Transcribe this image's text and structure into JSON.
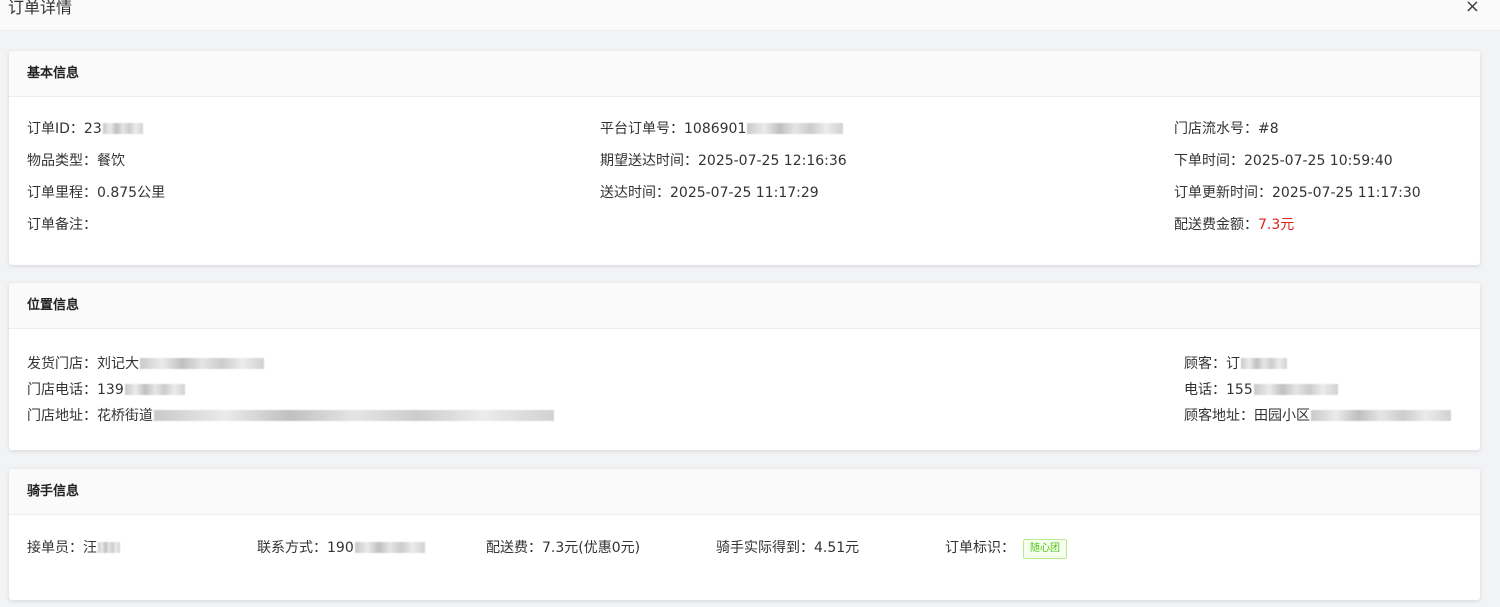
{
  "header": {
    "title": "订单详情",
    "close_symbol": "×"
  },
  "basic": {
    "title": "基本信息",
    "order_id": {
      "label": "订单ID：",
      "value": "23"
    },
    "platform_order_no": {
      "label": "平台订单号：",
      "value": "1086901"
    },
    "store_serial": {
      "label": "门店流水号：",
      "value": "#8"
    },
    "item_type": {
      "label": "物品类型：",
      "value": "餐饮"
    },
    "expected_delivery": {
      "label": "期望送达时间：",
      "value": "2025-07-25 12:16:36"
    },
    "order_time": {
      "label": "下单时间：",
      "value": "2025-07-25 10:59:40"
    },
    "distance": {
      "label": "订单里程：",
      "value": "0.875公里"
    },
    "delivered_time": {
      "label": "送达时间：",
      "value": "2025-07-25 11:17:29"
    },
    "update_time": {
      "label": "订单更新时间：",
      "value": "2025-07-25 11:17:30"
    },
    "remark": {
      "label": "订单备注：",
      "value": ""
    },
    "delivery_fee": {
      "label": "配送费金额：",
      "value": "7.3元"
    }
  },
  "location": {
    "title": "位置信息",
    "store": {
      "label": "发货门店：",
      "value": "刘记大"
    },
    "store_phone": {
      "label": "门店电话：",
      "value": "139"
    },
    "store_address": {
      "label": "门店地址：",
      "value": "花桥街道"
    },
    "customer": {
      "label": "顾客：",
      "value": "订"
    },
    "customer_phone": {
      "label": "电话：",
      "value": "155"
    },
    "customer_address": {
      "label": "顾客地址：",
      "value": "田园小区"
    }
  },
  "rider": {
    "title": "骑手信息",
    "receiver": {
      "label": "接单员：",
      "value": "汪"
    },
    "contact": {
      "label": "联系方式：",
      "value": "190"
    },
    "fee": {
      "label": "配送费：",
      "value": "7.3元(优惠0元)"
    },
    "actual_earnings": {
      "label": "骑手实际得到：",
      "value": "4.51元"
    },
    "order_tag": {
      "label": "订单标识：",
      "value": "随心团"
    }
  },
  "colors": {
    "accent_red": "#d9251b",
    "tag_green": "#52c41a"
  }
}
